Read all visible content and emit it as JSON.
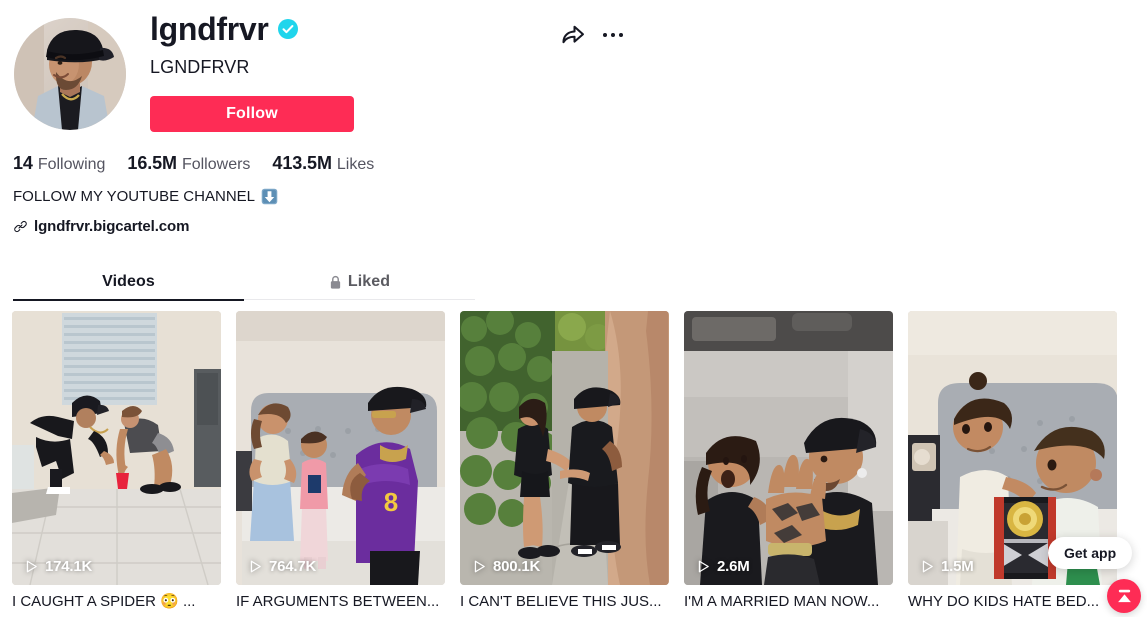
{
  "profile": {
    "username": "lgndfrvr",
    "verified_badge_icon": "verified-check-icon",
    "nickname": "LGNDFRVR",
    "avatar_icon": "profile-avatar",
    "follow_label": "Follow",
    "share_icon": "share-arrow-icon",
    "more_icon": "more-options-icon"
  },
  "stats": [
    {
      "value": "14",
      "label": "Following"
    },
    {
      "value": "16.5M",
      "label": "Followers"
    },
    {
      "value": "413.5M",
      "label": "Likes"
    }
  ],
  "bio": {
    "text": "FOLLOW MY YOUTUBE CHANNEL",
    "emoji_icon": "down-arrow-emoji",
    "link_icon": "link-chain-icon",
    "link_text": "lgndfrvr.bigcartel.com"
  },
  "tabs": [
    {
      "label": "Videos",
      "icon": null,
      "active": true
    },
    {
      "label": "Liked",
      "icon": "lock-icon",
      "active": false
    }
  ],
  "videos": [
    {
      "play_count": "174.1K",
      "caption": "I CAUGHT A SPIDER 😳 ...",
      "thumb_name": "video-thumbnail-spider"
    },
    {
      "play_count": "764.7K",
      "caption": "IF ARGUMENTS BETWEEN...",
      "thumb_name": "video-thumbnail-arguments"
    },
    {
      "play_count": "800.1K",
      "caption": "I CAN'T BELIEVE THIS JUS...",
      "thumb_name": "video-thumbnail-sidewalk"
    },
    {
      "play_count": "2.6M",
      "caption": "I'M A MARRIED MAN NOW...",
      "thumb_name": "video-thumbnail-car"
    },
    {
      "play_count": "1.5M",
      "caption": "WHY DO KIDS HATE BED...",
      "thumb_name": "video-thumbnail-kids"
    }
  ],
  "floating": {
    "get_app_label": "Get app",
    "scroll_top_icon": "scroll-to-top-icon"
  },
  "colors": {
    "brand_red": "#fe2c55",
    "verified_cyan": "#20d5ec",
    "text_primary": "#161823",
    "text_secondary": "#545460"
  }
}
